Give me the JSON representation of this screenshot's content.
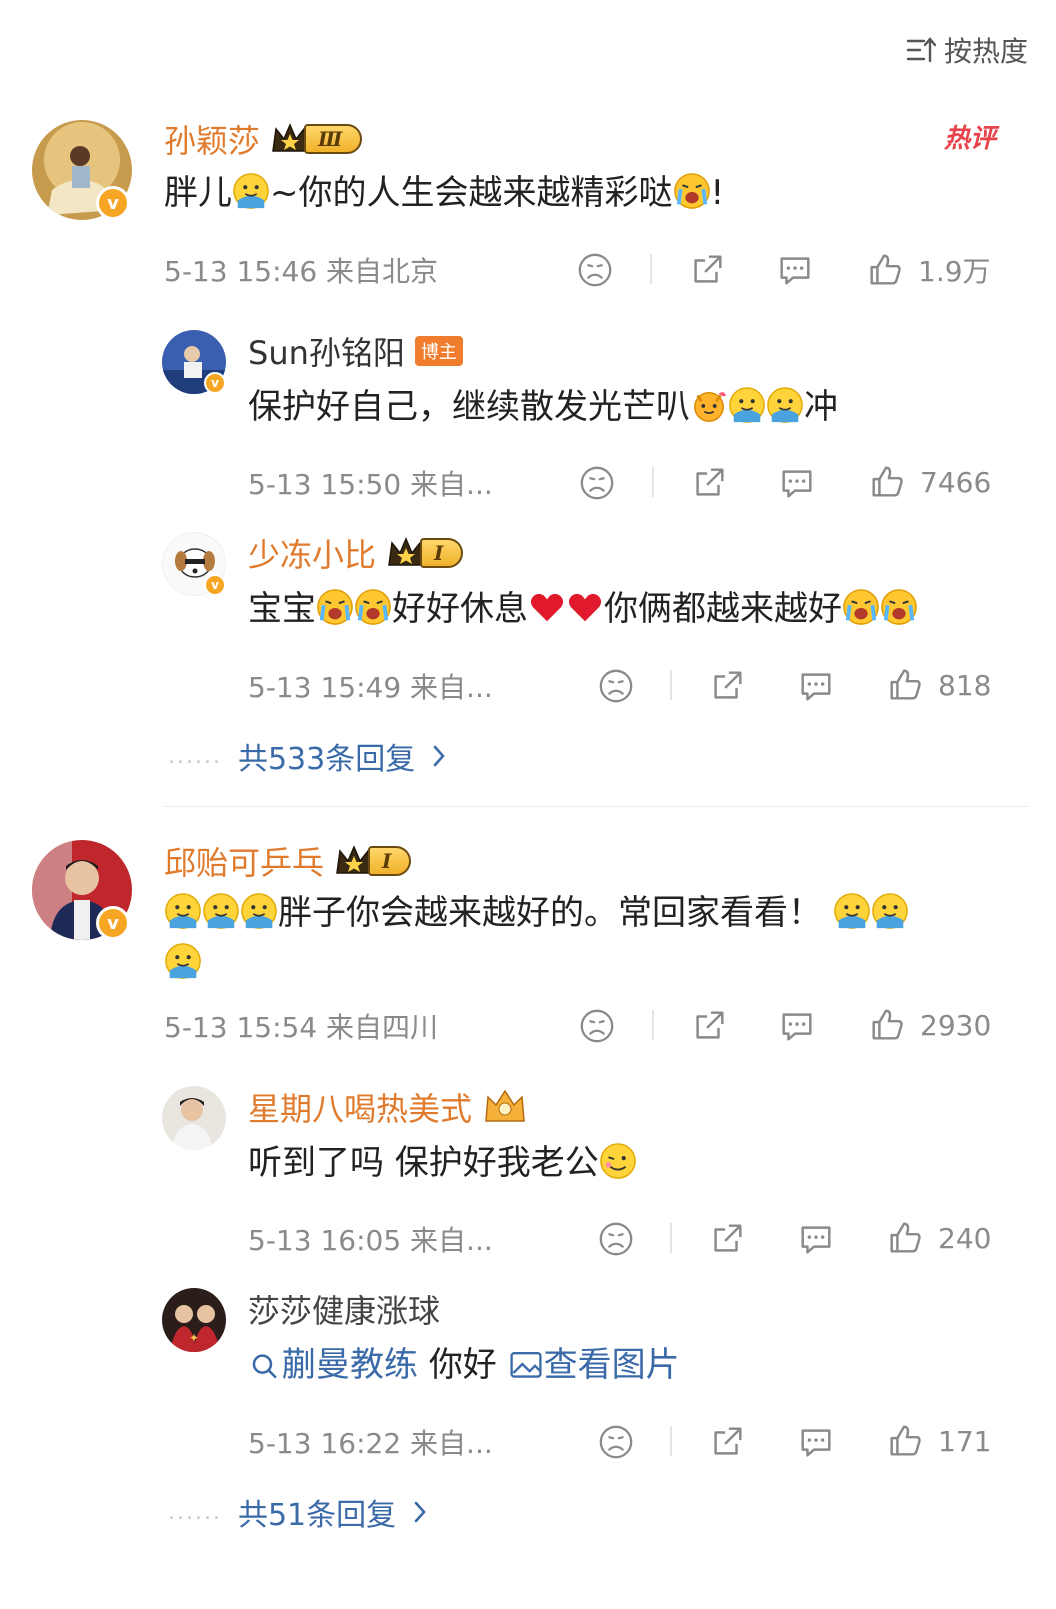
{
  "sort": {
    "label": "按热度"
  },
  "hot_tag": "热评",
  "comments": [
    {
      "username": "孙颖莎",
      "level": "Ⅲ",
      "text_a": "胖儿",
      "text_b": "~你的人生会越来越精彩哒",
      "text_c": "!",
      "time": "5-13 15:46  来自北京",
      "likes": "1.9万",
      "replies": [
        {
          "username": "Sun孙铭阳",
          "tag": "博主",
          "text_a": "保护好自己，继续散发光芒叭",
          "text_b": "冲",
          "time": "5-13 15:50  来自...",
          "likes": "7466"
        },
        {
          "username": "少冻小比",
          "level": "I",
          "text_a": "宝宝",
          "text_b": "好好休息",
          "text_c": "你俩都越来越好",
          "time": "5-13 15:49  来自...",
          "likes": "818"
        }
      ],
      "more_replies": "共533条回复"
    },
    {
      "username": "邱贻可乒乓",
      "level": "I",
      "text_a": "胖子你会越来越好的。常回家看看！",
      "time": "5-13 15:54  来自四川",
      "likes": "2930",
      "replies": [
        {
          "username": "星期八喝热美式",
          "text_a": "听到了吗 保护好我老公",
          "time": "5-13 16:05  来自...",
          "likes": "240"
        },
        {
          "username": "莎莎健康涨球",
          "link_a": "蒯曼教练",
          "text_a": "你好",
          "link_b": "查看图片",
          "time": "5-13 16:22  来自...",
          "likes": "171"
        }
      ],
      "more_replies": "共51条回复"
    }
  ],
  "icons": [
    "sort-icon",
    "sad-face-icon",
    "share-icon",
    "comment-icon",
    "like-icon",
    "crown-icon",
    "search-icon",
    "image-icon",
    "verified-badge-icon",
    "chevron-right-icon"
  ],
  "colors": {
    "username": "#e07b2d",
    "link": "#3a6aa8",
    "hot": "#e8424a",
    "meta": "#8a8a8a"
  }
}
